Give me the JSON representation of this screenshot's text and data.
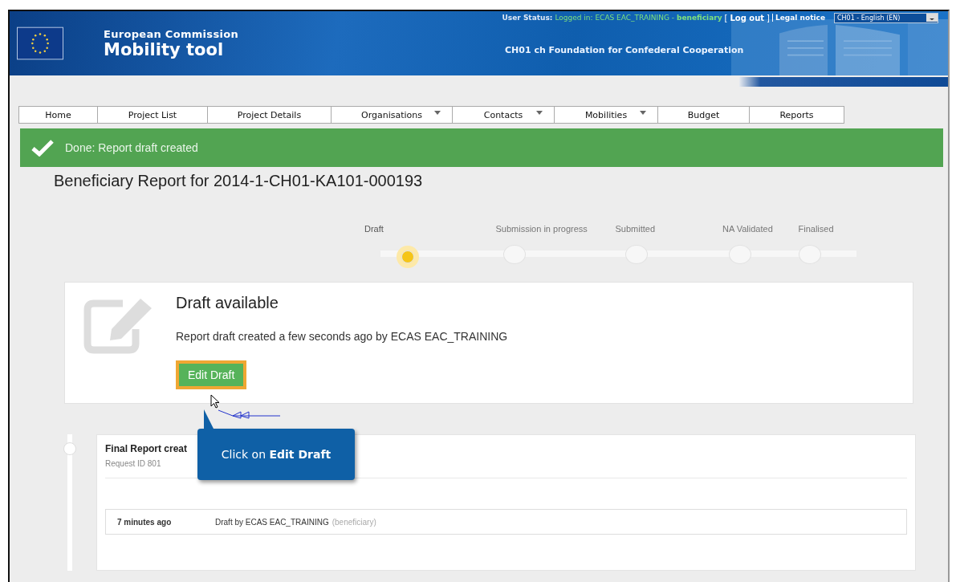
{
  "header": {
    "org": "European Commission",
    "app": "Mobility tool",
    "user_status_label": "User Status:",
    "logged_in": "Logged in: ECAS EAC_TRAINING -",
    "role": "beneficiary",
    "bracket_open": "[",
    "logout": "Log out",
    "bracket_close": "]",
    "legal_notice": "Legal notice",
    "language": "CH01 - English (EN)",
    "organisation": "CH01 ch Foundation for Confederal Cooperation"
  },
  "nav": [
    {
      "label": "Home",
      "dropdown": false
    },
    {
      "label": "Project List",
      "dropdown": false
    },
    {
      "label": "Project Details",
      "dropdown": false
    },
    {
      "label": "Organisations",
      "dropdown": true
    },
    {
      "label": "Contacts",
      "dropdown": true
    },
    {
      "label": "Mobilities",
      "dropdown": true
    },
    {
      "label": "Budget",
      "dropdown": false
    },
    {
      "label": "Reports",
      "dropdown": false
    }
  ],
  "banner": {
    "message": "Done: Report draft created"
  },
  "title": "Beneficiary Report for 2014-1-CH01-KA101-000193",
  "steps": [
    {
      "label": "Draft",
      "selected": true
    },
    {
      "label": "Submission in progress",
      "selected": false
    },
    {
      "label": "Submitted",
      "selected": false
    },
    {
      "label": "NA Validated",
      "selected": false
    },
    {
      "label": "Finalised",
      "selected": false
    }
  ],
  "draft_card": {
    "heading": "Draft available",
    "text": "Report draft created a few seconds ago by ECAS EAC_TRAINING",
    "button": "Edit Draft"
  },
  "callout": "Click on **Edit Draft**",
  "history": {
    "heading": "Final Report creat",
    "request": "Request ID 801",
    "entries": [
      {
        "time": "7 minutes ago",
        "text": "Draft by ECAS EAC_TRAINING",
        "role": "(beneficiary)"
      }
    ]
  }
}
